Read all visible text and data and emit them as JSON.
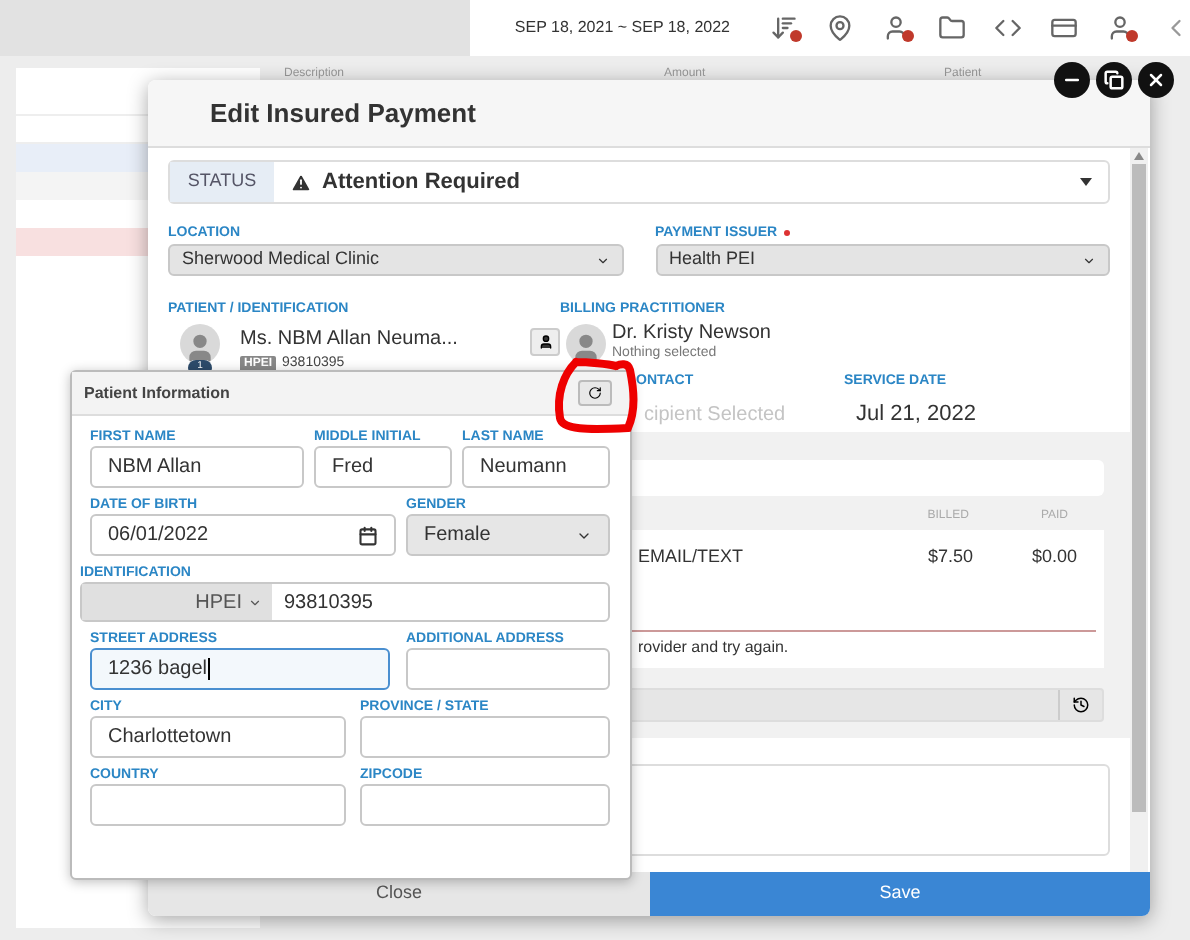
{
  "background": {
    "date_range": "SEP 18, 2021 ~ SEP 18, 2022",
    "columns": [
      "Description",
      "Amount",
      "Patient"
    ]
  },
  "dialog": {
    "title": "Edit Insured Payment",
    "status": {
      "label": "STATUS",
      "value": "Attention Required"
    },
    "location": {
      "label": "LOCATION",
      "value": "Sherwood Medical Clinic"
    },
    "payment_issuer": {
      "label": "PAYMENT ISSUER",
      "required": true,
      "value": "Health PEI"
    },
    "patient": {
      "label": "PATIENT / IDENTIFICATION",
      "name": "Ms. NBM Allan Neuma...",
      "badge": "1",
      "id_type": "HPEI",
      "id_number": "93810395"
    },
    "billing_practitioner": {
      "label": "BILLING PRACTITIONER",
      "name": "Dr. Kristy Newson",
      "note": "Nothing selected"
    },
    "contact": {
      "label": "ONTACT",
      "value": "cipient Selected"
    },
    "service_date": {
      "label": "SERVICE DATE",
      "value": "Jul 21, 2022"
    },
    "items": {
      "columns": [
        "BILLED",
        "PAID"
      ],
      "rows": [
        {
          "description": "EMAIL/TEXT",
          "billed": "$7.50",
          "paid": "$0.00"
        }
      ]
    },
    "error_message": "rovider and try again.",
    "buttons": [
      "Close",
      "Save"
    ]
  },
  "patient_popover": {
    "title": "Patient Information",
    "rows": [
      [
        {
          "kind": "text",
          "label": "FIRST NAME",
          "value": "NBM Allan",
          "focused": false
        },
        {
          "kind": "text",
          "label": "MIDDLE INITIAL",
          "value": "Fred",
          "focused": false
        },
        {
          "kind": "text",
          "label": "LAST NAME",
          "value": "Neumann",
          "focused": false
        }
      ],
      [
        {
          "kind": "date",
          "label": "DATE OF BIRTH",
          "value": "06/01/2022",
          "focused": false
        },
        {
          "kind": "select",
          "label": "GENDER",
          "value": "Female",
          "focused": false
        }
      ],
      [
        {
          "kind": "id",
          "label": "IDENTIFICATION",
          "prefix": "HPEI",
          "value": "93810395",
          "focused": false
        }
      ],
      [
        {
          "kind": "text",
          "label": "STREET ADDRESS",
          "value": "1236 bagel",
          "focused": true
        },
        {
          "kind": "text",
          "label": "ADDITIONAL ADDRESS",
          "focused": false
        }
      ],
      [
        {
          "kind": "text",
          "label": "CITY",
          "value": "Charlottetown",
          "focused": false
        },
        {
          "kind": "text",
          "label": "PROVINCE / STATE",
          "focused": false
        }
      ],
      [
        {
          "kind": "text",
          "label": "COUNTRY",
          "focused": false
        },
        {
          "kind": "text",
          "label": "ZIPCODE",
          "focused": false
        }
      ]
    ]
  }
}
